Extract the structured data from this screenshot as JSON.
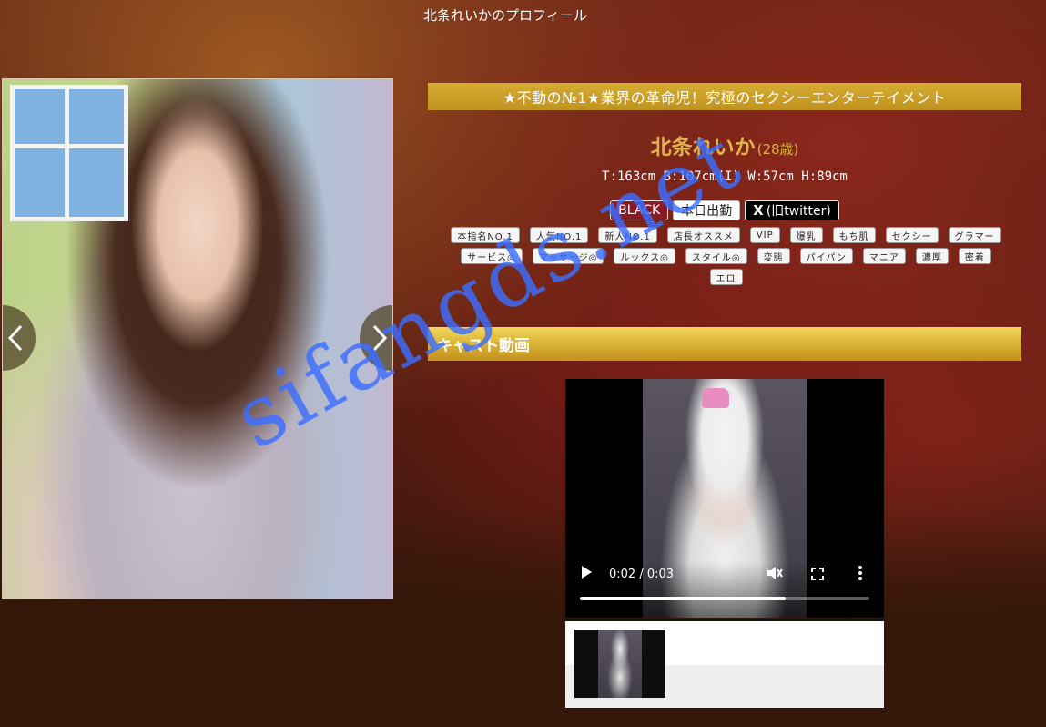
{
  "page": {
    "title": "北条れいかのプロフィール"
  },
  "gallery": {
    "prev_icon": "chevron-left-icon",
    "next_icon": "chevron-right-icon"
  },
  "profile": {
    "catchphrase": "★不動の№1★業界の革命児！究極のセクシーエンターテイメント",
    "name": "北条れいか",
    "age": "(28歳)",
    "measurements": "T:163cm B:107cm(I) W:57cm H:89cm",
    "status_black": "BLACK",
    "status_today": "本日出勤",
    "x_icon": "X",
    "status_twitter": "(旧twitter)",
    "tags": [
      "本指名NO.1",
      "人気NO.1",
      "新人NO.1",
      "店長オススメ",
      "VIP",
      "爆乳",
      "もち肌",
      "セクシー",
      "グラマー",
      "サービス◎",
      "マッサージ◎",
      "ルックス◎",
      "スタイル◎",
      "変態",
      "パイパン",
      "マニア",
      "濃厚",
      "密着",
      "エロ"
    ]
  },
  "video_section": {
    "heading": "キャスト動画"
  },
  "video": {
    "time": "0:02 / 0:03",
    "progress": 0.71
  },
  "colors": {
    "accent_gold": "#d6ad33",
    "name_gold": "#e1b24a",
    "black_badge": "#8a1a24"
  },
  "watermark": "sifangds.net"
}
